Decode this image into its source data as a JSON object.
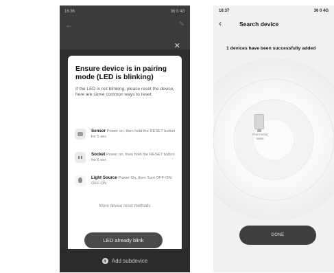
{
  "left_screen": {
    "status_time": "16:36",
    "status_right": "36 0 4G",
    "modal": {
      "title": "Ensure device is in pairing mode (LED is blinking)",
      "description": "If the LED is not blinking, please reset the device, here are some common ways to reset:",
      "items": [
        {
          "name": "Sensor",
          "instruction": "Power on, then hold the RESET button for 5 sec",
          "icon": "sensor-icon"
        },
        {
          "name": "Socket",
          "instruction": "Power on, then hold the RESET button for 5 sec",
          "icon": "socket-icon"
        },
        {
          "name": "Light Source",
          "instruction": "Power On, then Turn OFF-ON-OFF-ON",
          "icon": "bulb-icon"
        }
      ],
      "more_link": "More device reset methods",
      "confirm_button": "LED already blink",
      "close_icon": "close-icon"
    },
    "bottom_action": "Add subdevice"
  },
  "right_screen": {
    "status_time": "16:37",
    "status_right": "36 0 4G",
    "nav_title": "Search device",
    "success_message": "1 devices have been successfully added",
    "device": {
      "label_line1": "Thermostat",
      "label_line2": "Valve"
    },
    "done_button": "DONE"
  },
  "colors": {
    "dark_overlay": "#3b3b3b",
    "button_dark": "#4a4a4a",
    "radar_bg": "#f1f1f1"
  }
}
